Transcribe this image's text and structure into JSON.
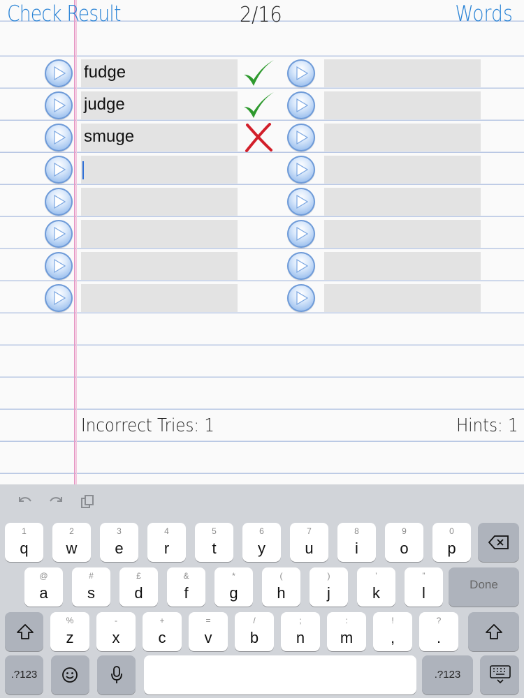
{
  "header": {
    "left_button": "Check Result",
    "progress": "2/16",
    "right_button": "Words"
  },
  "left_column": [
    {
      "text": "fudge",
      "result": "correct"
    },
    {
      "text": "judge",
      "result": "correct"
    },
    {
      "text": "smuge",
      "result": "incorrect"
    },
    {
      "text": "",
      "focused": true
    },
    {
      "text": ""
    },
    {
      "text": ""
    },
    {
      "text": ""
    },
    {
      "text": ""
    }
  ],
  "right_column": [
    {
      "text": ""
    },
    {
      "text": ""
    },
    {
      "text": ""
    },
    {
      "text": ""
    },
    {
      "text": ""
    },
    {
      "text": ""
    },
    {
      "text": ""
    },
    {
      "text": ""
    }
  ],
  "footer": {
    "incorrect_tries": "Incorrect Tries: 1",
    "hints": "Hints: 1"
  },
  "keyboard": {
    "row1": [
      {
        "hint": "1",
        "key": "q"
      },
      {
        "hint": "2",
        "key": "w"
      },
      {
        "hint": "3",
        "key": "e"
      },
      {
        "hint": "4",
        "key": "r"
      },
      {
        "hint": "5",
        "key": "t"
      },
      {
        "hint": "6",
        "key": "y"
      },
      {
        "hint": "7",
        "key": "u"
      },
      {
        "hint": "8",
        "key": "i"
      },
      {
        "hint": "9",
        "key": "o"
      },
      {
        "hint": "0",
        "key": "p"
      }
    ],
    "row2": [
      {
        "hint": "@",
        "key": "a"
      },
      {
        "hint": "#",
        "key": "s"
      },
      {
        "hint": "£",
        "key": "d"
      },
      {
        "hint": "&",
        "key": "f"
      },
      {
        "hint": "*",
        "key": "g"
      },
      {
        "hint": "(",
        "key": "h"
      },
      {
        "hint": ")",
        "key": "j"
      },
      {
        "hint": "’",
        "key": "k"
      },
      {
        "hint": "”",
        "key": "l"
      }
    ],
    "row3": [
      {
        "hint": "%",
        "key": "z"
      },
      {
        "hint": "-",
        "key": "x"
      },
      {
        "hint": "+",
        "key": "c"
      },
      {
        "hint": "=",
        "key": "v"
      },
      {
        "hint": "/",
        "key": "b"
      },
      {
        "hint": ";",
        "key": "n"
      },
      {
        "hint": ":",
        "key": "m"
      },
      {
        "hint": "!",
        "key": ","
      },
      {
        "hint": "?",
        "key": "."
      }
    ],
    "done_label": "Done",
    "numbers_label": ".?123"
  },
  "colors": {
    "accent": "#2b84d6",
    "correct": "#2e9a2e",
    "incorrect": "#d21f2a",
    "field": "#e3e3e3"
  }
}
